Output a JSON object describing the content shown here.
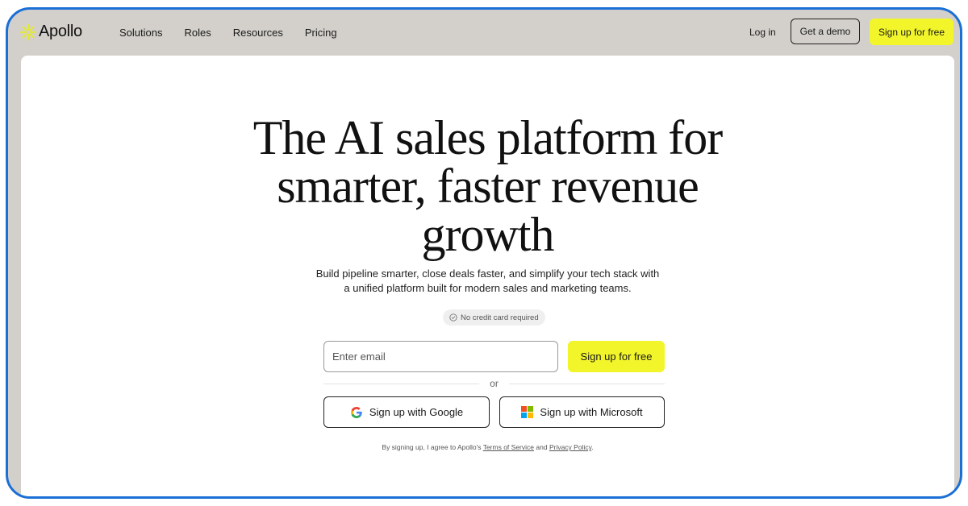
{
  "nav": {
    "logo_text": "Apollo",
    "links": [
      "Solutions",
      "Roles",
      "Resources",
      "Pricing"
    ],
    "login": "Log in",
    "demo": "Get a demo",
    "signup": "Sign up for free"
  },
  "hero": {
    "headline_lines": [
      "The AI sales platform for",
      "smarter, faster revenue",
      "growth"
    ],
    "subtext_lines": [
      "Build pipeline smarter, close deals faster, and simplify your tech stack with",
      "a unified platform built for modern sales and marketing teams."
    ],
    "badge": "No credit card required"
  },
  "form": {
    "email_placeholder": "Enter email",
    "signup": "Sign up for free",
    "or": "or",
    "google": "Sign up with Google",
    "microsoft": "Sign up with Microsoft"
  },
  "legal": {
    "prefix": "By signing up, I agree to Apollo's",
    "terms": "Terms of Service",
    "and": "and",
    "privacy": "Privacy Policy",
    "suffix": "."
  },
  "icons": {
    "logo": "apollo-sunburst-icon",
    "badge": "check-circle-icon",
    "google": "google-icon",
    "microsoft": "microsoft-icon"
  },
  "colors": {
    "accent": "#f2f52a",
    "frame": "#1a6fd6",
    "nav_bg": "#d3d0cb",
    "panel_bg": "#ffffff",
    "ms_red": "#f25022",
    "ms_green": "#7fba00",
    "ms_blue": "#00a4ef",
    "ms_yellow": "#ffb900"
  }
}
